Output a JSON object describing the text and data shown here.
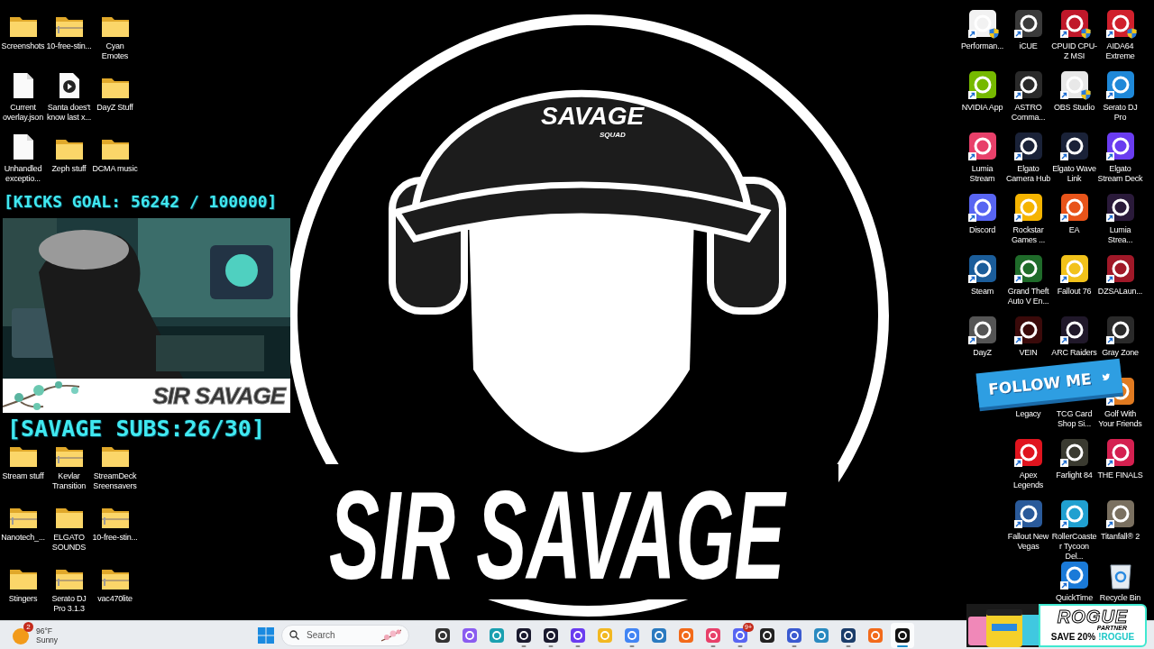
{
  "desktop_left": {
    "top": [
      {
        "label": "Screenshots",
        "kind": "folder"
      },
      {
        "label": "10-free-stin...",
        "kind": "zip-folder"
      },
      {
        "label": "Cyan Emotes",
        "kind": "folder"
      },
      {
        "label": "Current overlay.json",
        "kind": "file"
      },
      {
        "label": "Santa does't know last x...",
        "kind": "media-file"
      },
      {
        "label": "DayZ Stuff",
        "kind": "folder"
      },
      {
        "label": "Unhandled exceptio...",
        "kind": "file"
      },
      {
        "label": "Zeph stuff",
        "kind": "folder"
      },
      {
        "label": "DCMA music",
        "kind": "folder"
      }
    ],
    "bottom": [
      {
        "label": "Stream stuff",
        "kind": "folder"
      },
      {
        "label": "Kevlar Transition",
        "kind": "zip-folder"
      },
      {
        "label": "StreamDeck Sreensavers",
        "kind": "folder"
      },
      {
        "label": "Nanotech_...",
        "kind": "zip-folder"
      },
      {
        "label": "ELGATO SOUNDS",
        "kind": "folder"
      },
      {
        "label": "10-free-stin...",
        "kind": "zip-folder"
      },
      {
        "label": "Stingers",
        "kind": "folder"
      },
      {
        "label": "Serato DJ Pro 3.1.3",
        "kind": "zip-folder"
      },
      {
        "label": "vac470lite",
        "kind": "zip-folder"
      }
    ]
  },
  "desktop_right": {
    "rows": [
      {
        "items": [
          {
            "label": "Performan...",
            "kind": "app",
            "color": "#f2f2f2",
            "shortcut": true,
            "shield": true
          },
          {
            "label": "iCUE",
            "kind": "app",
            "color": "#3a3a3a",
            "shortcut": true,
            "shield": false
          },
          {
            "label": "CPUID CPU-Z MSI",
            "kind": "app",
            "color": "#c0182a",
            "shortcut": true,
            "shield": true
          },
          {
            "label": "AIDA64 Extreme",
            "kind": "app",
            "color": "#d0202c",
            "shortcut": true,
            "shield": true
          }
        ]
      },
      {
        "items": [
          {
            "label": "NVIDIA App",
            "kind": "app",
            "color": "#76b900",
            "shortcut": true,
            "shield": false
          },
          {
            "label": "ASTRO Comma...",
            "kind": "app",
            "color": "#2a2a2a",
            "shortcut": true,
            "shield": false
          },
          {
            "label": "OBS Studio",
            "kind": "app",
            "color": "#e8e8e8",
            "shortcut": true,
            "shield": true
          },
          {
            "label": "Serato DJ Pro",
            "kind": "app",
            "color": "#1e88d8",
            "shortcut": true,
            "shield": false
          }
        ]
      },
      {
        "items": [
          {
            "label": "Lumia Stream",
            "kind": "app",
            "color": "#e8406a",
            "shortcut": true,
            "shield": false
          },
          {
            "label": "Elgato Camera Hub",
            "kind": "app",
            "color": "#1a2238",
            "shortcut": true,
            "shield": false
          },
          {
            "label": "Elgato Wave Link",
            "kind": "app",
            "color": "#1a2238",
            "shortcut": true,
            "shield": false
          },
          {
            "label": "Elgato Stream Deck",
            "kind": "app",
            "color": "#6a3cf0",
            "shortcut": true,
            "shield": false
          }
        ]
      },
      {
        "items": [
          {
            "label": "Discord",
            "kind": "app",
            "color": "#5865f2",
            "shortcut": true,
            "shield": false
          },
          {
            "label": "Rockstar Games ...",
            "kind": "app",
            "color": "#f5b400",
            "shortcut": true,
            "shield": false
          },
          {
            "label": "EA",
            "kind": "app",
            "color": "#e8541a",
            "shortcut": true,
            "shield": false
          },
          {
            "label": "Lumia Strea...",
            "kind": "app",
            "color": "#2a1a3a",
            "shortcut": true,
            "shield": false
          }
        ]
      },
      {
        "items": [
          {
            "label": "Steam",
            "kind": "app",
            "color": "#1b5d9a",
            "shortcut": true,
            "shield": false
          },
          {
            "label": "Grand Theft Auto V En...",
            "kind": "app",
            "color": "#1f6b2a",
            "shortcut": true,
            "shield": false
          },
          {
            "label": "Fallout 76",
            "kind": "app",
            "color": "#f2c21a",
            "shortcut": true,
            "shield": false
          },
          {
            "label": "DZSALaun...",
            "kind": "app",
            "color": "#a01828",
            "shortcut": true,
            "shield": false
          }
        ]
      },
      {
        "items": [
          {
            "label": "DayZ",
            "kind": "app",
            "color": "#555555",
            "shortcut": true,
            "shield": false
          },
          {
            "label": "VEIN",
            "kind": "app",
            "color": "#3a0a0a",
            "shortcut": true,
            "shield": false
          },
          {
            "label": "ARC Raiders",
            "kind": "app",
            "color": "#20182a",
            "shortcut": true,
            "shield": false
          },
          {
            "label": "Gray Zone",
            "kind": "app",
            "color": "#2a2a2a",
            "shortcut": true,
            "shield": false
          }
        ]
      },
      {
        "items": [
          {
            "label": "Legacy",
            "kind": "app",
            "shield": false
          },
          {
            "label": "TCG Card Shop Si...",
            "kind": "app",
            "shield": false
          },
          {
            "label": "Golf With Your Friends",
            "kind": "app",
            "color": "#e07a20",
            "shortcut": true,
            "shield": false
          }
        ]
      },
      {
        "items": [
          {
            "label": "Apex Legends",
            "kind": "app",
            "color": "#e0141e",
            "shortcut": true,
            "shield": false
          },
          {
            "label": "Farlight 84",
            "kind": "app",
            "color": "#3a3a30",
            "shortcut": true,
            "shield": false
          },
          {
            "label": "THE FINALS",
            "kind": "app",
            "color": "#d42050",
            "shortcut": true,
            "shield": false
          }
        ]
      },
      {
        "items": [
          {
            "label": "Fallout New Vegas",
            "kind": "app",
            "color": "#2a5a9a",
            "shortcut": true,
            "shield": false
          },
          {
            "label": "RollerCoaster Tycoon Del...",
            "kind": "app",
            "color": "#20a0d0",
            "shortcut": true,
            "shield": false
          },
          {
            "label": "Titanfall® 2",
            "kind": "app",
            "color": "#7a7060",
            "shortcut": true,
            "shield": false
          }
        ]
      },
      {
        "items": [
          {
            "label": "QuickTime",
            "kind": "app",
            "color": "#1a7ad8",
            "shortcut": true,
            "shield": false
          },
          {
            "label": "Recycle Bin",
            "kind": "bin",
            "shortcut": false,
            "shield": false
          }
        ]
      }
    ]
  },
  "logo": {
    "title": "SIR SAVAGE",
    "cap_text": "SAVAGE",
    "cap_subtext": "SQUAD"
  },
  "stream_overlay": {
    "goal": "[KICKS GOAL: 56242 / 100000]",
    "webcam_banner": "SIR SAVAGE",
    "subs": "[SAVAGE SUBS:26/30]"
  },
  "follow_banner": {
    "text": "FOLLOW ME"
  },
  "promo": {
    "brand": "ROGUE",
    "tag": "PARTNER",
    "offer": "SAVE 20%",
    "code": "!ROGUE"
  },
  "taskbar": {
    "weather": {
      "badge": "2",
      "temperature": "96°F",
      "condition": "Sunny"
    },
    "search": {
      "placeholder": "Search"
    },
    "apps": [
      {
        "color": "#333333",
        "running": false,
        "selected": false
      },
      {
        "color": "#8a5cf0",
        "running": false,
        "selected": false
      },
      {
        "color": "#1aa0b0",
        "running": false,
        "selected": false
      },
      {
        "color": "#1a1a2e",
        "running": true,
        "selected": false
      },
      {
        "color": "#1a1a2e",
        "running": true,
        "selected": false
      },
      {
        "color": "#6a3cf0",
        "running": true,
        "selected": false
      },
      {
        "color": "#f2b822",
        "running": false,
        "selected": false
      },
      {
        "color": "#4285f4",
        "running": true,
        "selected": false
      },
      {
        "color": "#2a7ac0",
        "running": false,
        "selected": false
      },
      {
        "color": "#f26a1a",
        "running": false,
        "selected": false
      },
      {
        "color": "#e8406a",
        "running": true,
        "selected": false
      },
      {
        "color": "#5865f2",
        "running": true,
        "selected": false,
        "badge": "9+"
      },
      {
        "color": "#222222",
        "running": false,
        "selected": false
      },
      {
        "color": "#3a5ad0",
        "running": true,
        "selected": false
      },
      {
        "color": "#2a8ac0",
        "running": false,
        "selected": false
      },
      {
        "color": "#1b3d6a",
        "running": true,
        "selected": false
      },
      {
        "color": "#f26a1a",
        "running": false,
        "selected": false
      },
      {
        "color": "#111111",
        "running": true,
        "selected": true
      }
    ]
  }
}
